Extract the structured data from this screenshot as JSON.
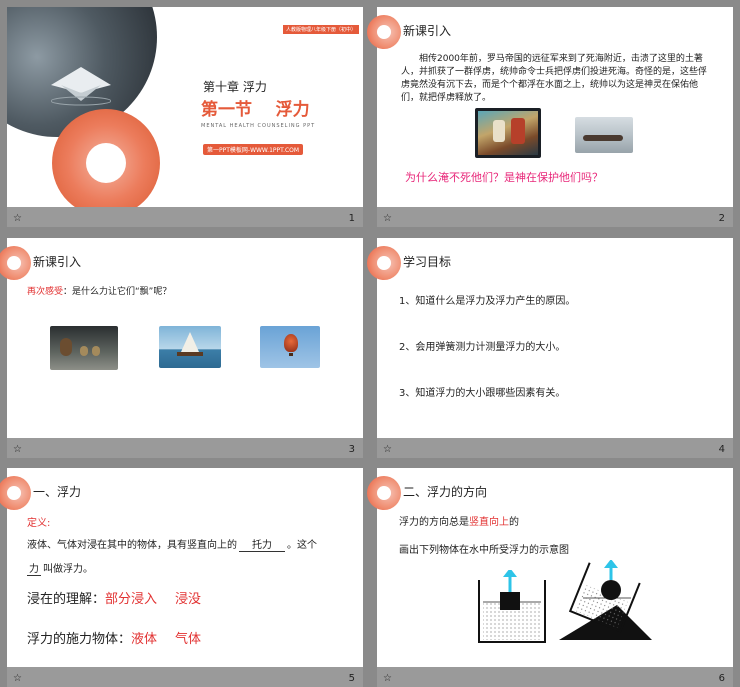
{
  "slide1": {
    "publisher_badge": "人教版物理八年级下册（初中）",
    "chapter": "第十章  浮力",
    "section": "第一节    浮力",
    "subtitle_en": "MENTAL HEALTH COUNSELING PPT",
    "site_badge": "第一PPT模板网-WWW.1PPT.COM",
    "page": "1"
  },
  "slide2": {
    "title": "新课引入",
    "story": "相传2000年前，罗马帝国的远征军来到了死海附近，击溃了这里的土著人，并抓获了一群俘虏，统帅命令士兵把俘虏们投进死海。奇怪的是，这些俘虏竟然没有沉下去，而是个个都浮在水面之上，统帅以为这是神灵在保佑他们，就把俘虏释放了。",
    "question": "为什么淹不死他们？是神在保护他们吗？",
    "page": "2"
  },
  "slide3": {
    "title": "新课引入",
    "prompt_label": "再次感受",
    "prompt_text": "：是什么力让它们“飘”呢？",
    "page": "3"
  },
  "slide4": {
    "title": "学习目标",
    "goals": [
      "1、知道什么是浮力及浮力产生的原因。",
      "2、会用弹簧测力计测量浮力的大小。",
      "3、知道浮力的大小跟哪些因素有关。"
    ],
    "page": "4"
  },
  "slide5": {
    "title": "一、浮力",
    "def_label": "定义:",
    "def_line1_a": "液体、气体对浸在其中的物体，具有竖直向上的",
    "def_blank1": "托力",
    "def_line1_b": "。这个",
    "def_blank2": "力",
    "def_line2_b": "叫做浮力。",
    "immersion_label": "浸在的理解：",
    "immersion_a": "部分浸入",
    "immersion_b": "浸没",
    "exerter_label": "浮力的施力物体：",
    "exerter_a": "液体",
    "exerter_b": "气体",
    "page": "5"
  },
  "slide6": {
    "title": "二、浮力的方向",
    "line1_a": "浮力的方向总是",
    "line1_b": "竖直向上",
    "line1_c": "的",
    "line2": "画出下列物体在水中所受浮力的示意图",
    "page": "6"
  },
  "colors": {
    "accent": "#e55a3a",
    "red_text": "#e23232",
    "magenta_text": "#e8287a",
    "arrow": "#2ec4e8"
  }
}
